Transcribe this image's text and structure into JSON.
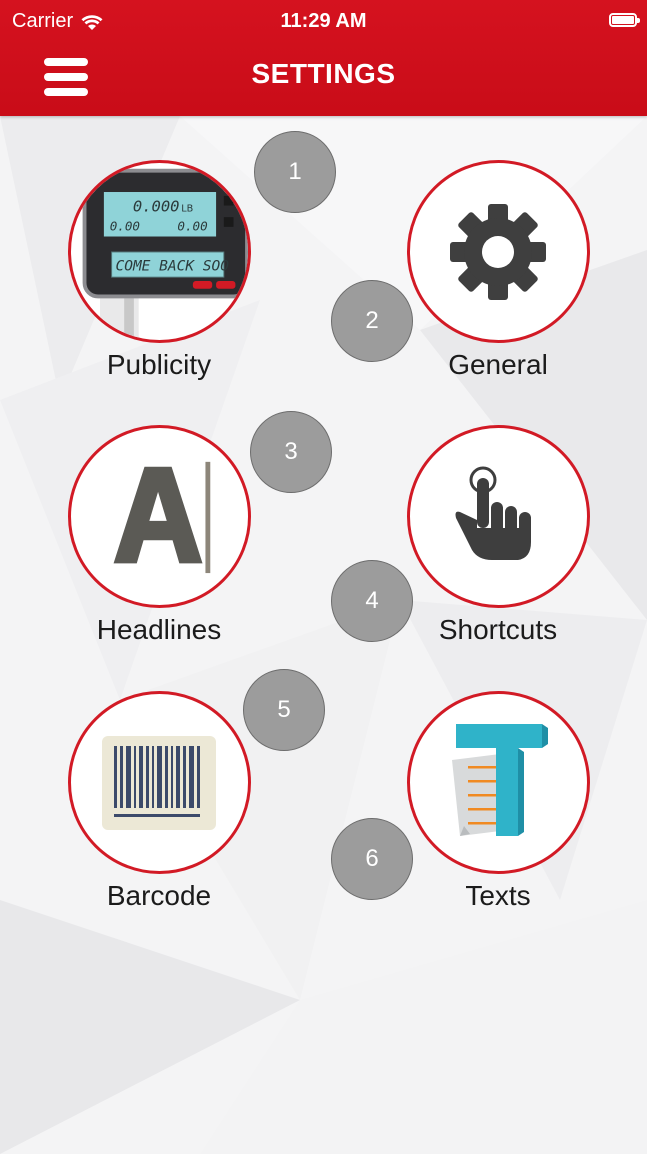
{
  "status_bar": {
    "carrier": "Carrier",
    "time": "11:29 AM"
  },
  "header": {
    "title": "SETTINGS"
  },
  "tiles": [
    {
      "label": "Publicity",
      "icon": "scale-display-icon"
    },
    {
      "label": "General",
      "icon": "gear-icon"
    },
    {
      "label": "Headlines",
      "icon": "letter-a-icon"
    },
    {
      "label": "Shortcuts",
      "icon": "pointing-hand-icon"
    },
    {
      "label": "Barcode",
      "icon": "barcode-icon"
    },
    {
      "label": "Texts",
      "icon": "text-document-icon"
    }
  ],
  "scale_display": {
    "weight": "0.000",
    "unit": "LB",
    "value_a": "0.00",
    "value_b": "0.00",
    "message": "COME BACK SOO"
  },
  "badges": [
    "1",
    "2",
    "3",
    "4",
    "5",
    "6"
  ],
  "colors": {
    "accent": "#d5121f",
    "badge": "#9c9c9c"
  }
}
